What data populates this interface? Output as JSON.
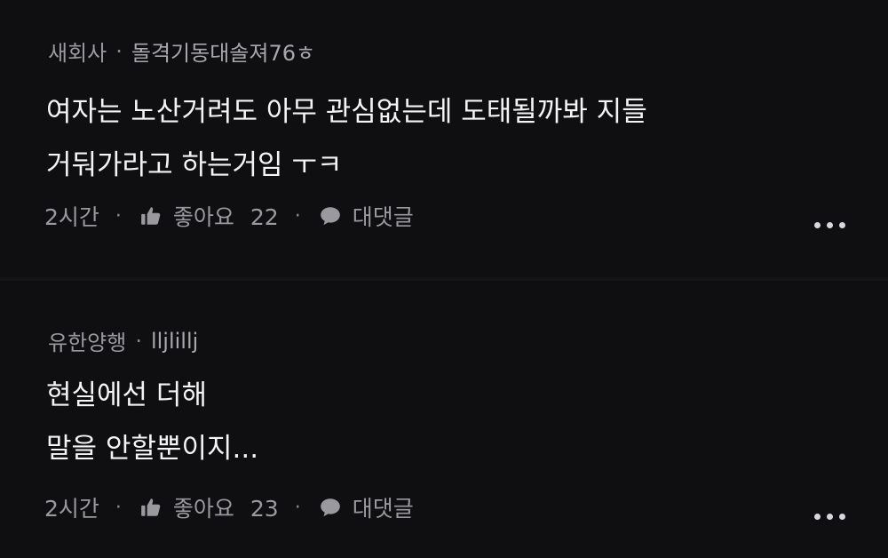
{
  "comments": [
    {
      "author": "새회사",
      "tag": "돌격기동대솔져76ㅎ",
      "lines": [
        "여자는 노산거려도 아무 관심없는데 도태될까봐 지들",
        "거둬가라고 하는거임 ㅜㅋ"
      ],
      "time": "2시간",
      "like_label": "좋아요",
      "like_count": "22",
      "reply_label": "대댓글"
    },
    {
      "author": "유한양행",
      "tag": "lljlillj",
      "lines": [
        "현실에선 더해",
        "말을 안할뿐이지..."
      ],
      "time": "2시간",
      "like_label": "좋아요",
      "like_count": "23",
      "reply_label": "대댓글"
    }
  ],
  "separator_char": "·",
  "icons": {
    "like": "thumbs-up-icon",
    "reply": "speech-bubble-icon",
    "more": "more-options-icon"
  },
  "colors": {
    "background": "#0f0f11",
    "text": "#f4f4f4",
    "muted": "#9a9a9e"
  }
}
